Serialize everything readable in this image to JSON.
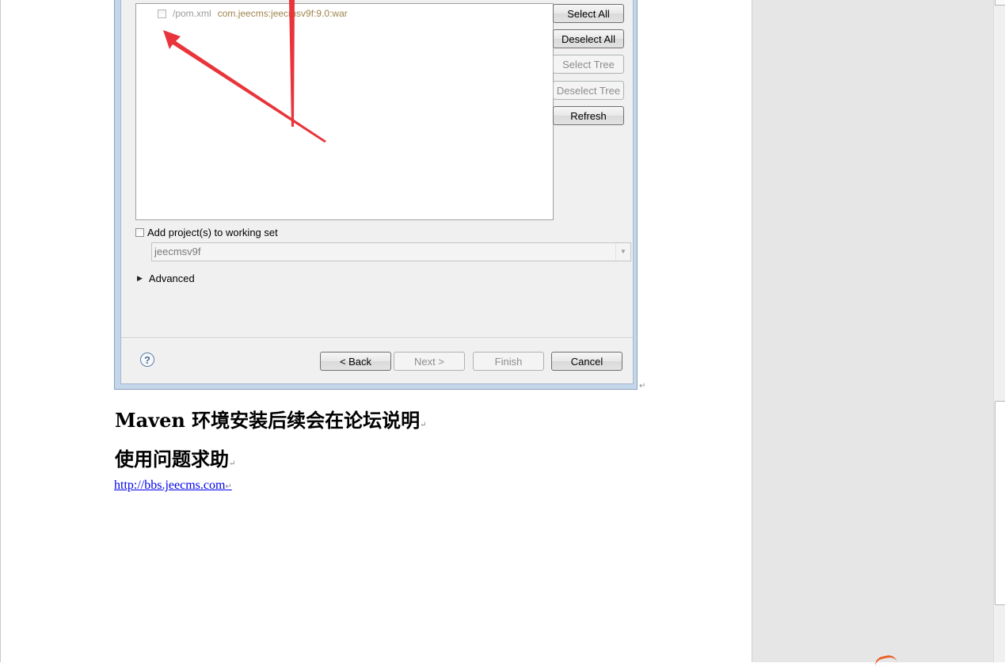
{
  "dialog": {
    "project_row": {
      "path": "/pom.xml",
      "artifact": "com.jeecms:jeecmsv9f:9.0:war"
    },
    "side_buttons": {
      "select_all": "Select All",
      "deselect_all": "Deselect All",
      "select_tree": "Select Tree",
      "deselect_tree": "Deselect Tree",
      "refresh": "Refresh"
    },
    "working_set": {
      "checkbox_label": "Add project(s) to working set",
      "combo_value": "jeecmsv9f"
    },
    "advanced_label": "Advanced",
    "footer_buttons": {
      "back": "< Back",
      "next": "Next >",
      "finish": "Finish",
      "cancel": "Cancel"
    },
    "help_glyph": "?"
  },
  "document": {
    "heading1": "Maven 环境安装后续会在论坛说明",
    "heading2": "使用问题求助",
    "link": "http://bbs.jeecms.com",
    "paragraph_mark": "↵"
  },
  "colors": {
    "annotation_arrow": "#e8343a",
    "link": "#0000ee",
    "artifact_text": "#a0854f"
  },
  "icons": [
    "help-icon",
    "checkbox-icon",
    "expand-triangle-icon",
    "dropdown-arrow-icon",
    "red-arrow-annotation"
  ]
}
